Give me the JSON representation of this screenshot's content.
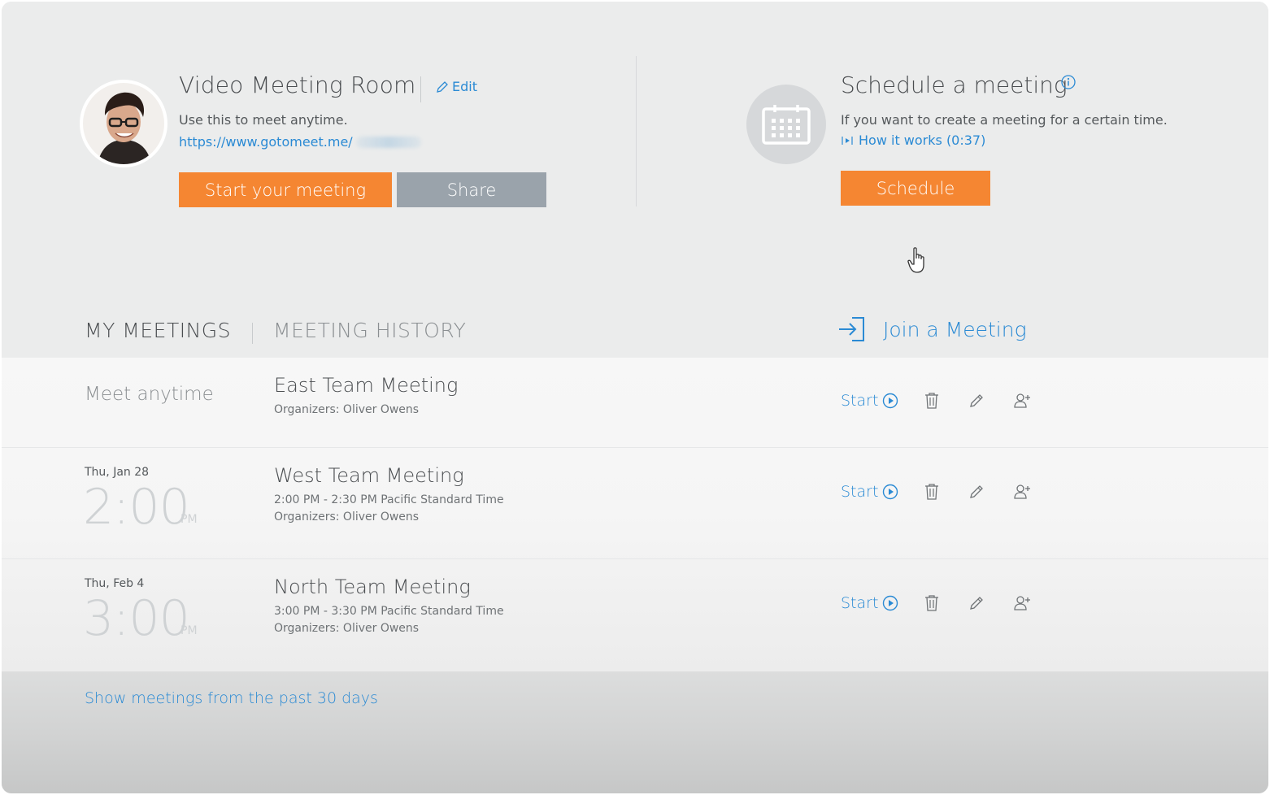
{
  "room": {
    "title": "Video Meeting Room",
    "edit_label": "Edit",
    "description": "Use this to meet anytime.",
    "url": "https://www.gotomeet.me/",
    "start_button": "Start your meeting",
    "share_button": "Share"
  },
  "schedule": {
    "title": "Schedule a meeting",
    "description": "If you want to create a meeting for a certain time.",
    "how_it_works": "How it works (0:37)",
    "button": "Schedule"
  },
  "tabs": {
    "my_meetings": "MY MEETINGS",
    "meeting_history": "MEETING HISTORY"
  },
  "join": {
    "label": "Join a Meeting"
  },
  "meetings": [
    {
      "when_label": "Meet anytime",
      "title": "East Team Meeting",
      "organizers": "Organizers: Oliver Owens",
      "start_label": "Start"
    },
    {
      "date": "Thu, Jan 28",
      "time": "2:00",
      "ampm": "PM",
      "title": "West Team Meeting",
      "time_range": "2:00 PM - 2:30 PM Pacific Standard Time",
      "organizers": "Organizers: Oliver Owens",
      "start_label": "Start"
    },
    {
      "date": "Thu, Feb 4",
      "time": "3:00",
      "ampm": "PM",
      "title": "North Team Meeting",
      "time_range": "3:00 PM - 3:30 PM Pacific Standard Time",
      "organizers": "Organizers: Oliver Owens",
      "start_label": "Start"
    }
  ],
  "footer": {
    "show_past": "Show meetings from the past 30 days"
  },
  "colors": {
    "accent_orange": "#f58632",
    "link_blue": "#2a8ad4",
    "share_gray": "#9aa3ab",
    "background": "#ebecec"
  },
  "icons": [
    "avatar-photo",
    "pencil-icon",
    "calendar-icon",
    "info-icon",
    "play-icon",
    "sign-in-icon",
    "trash-icon",
    "edit-icon",
    "add-user-icon",
    "hand-cursor-icon"
  ]
}
